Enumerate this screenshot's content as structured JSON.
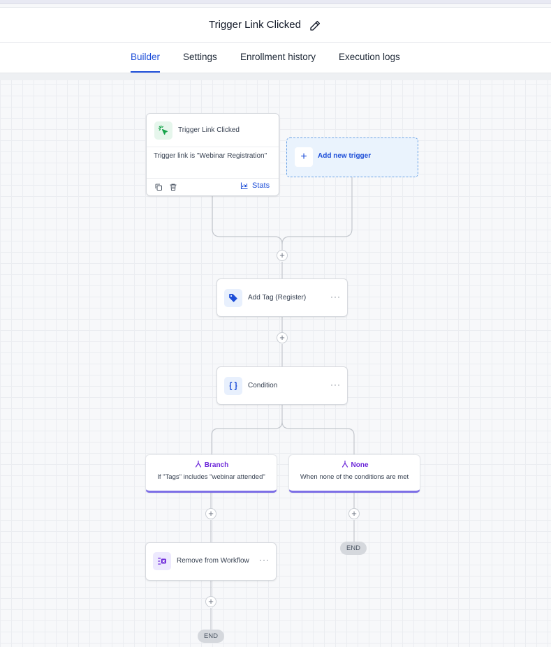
{
  "header": {
    "title": "Trigger Link Clicked"
  },
  "tabs": [
    {
      "label": "Builder",
      "active": true
    },
    {
      "label": "Settings",
      "active": false
    },
    {
      "label": "Enrollment history",
      "active": false
    },
    {
      "label": "Execution logs",
      "active": false
    }
  ],
  "trigger": {
    "name": "Trigger Link Clicked",
    "detail": "Trigger link is \"Webinar Registration\"",
    "stats_label": "Stats"
  },
  "add_trigger": {
    "label": "Add new trigger"
  },
  "actions": {
    "add_tag": {
      "label": "Add Tag (Register)"
    },
    "condition": {
      "label": "Condition"
    },
    "remove": {
      "label": "Remove from Workflow"
    }
  },
  "branches": {
    "branch": {
      "title": "Branch",
      "desc": "If \"Tags\" includes \"webinar attended\""
    },
    "none": {
      "title": "None",
      "desc": "When none of the conditions are met"
    }
  },
  "plus_symbol": "+",
  "more_symbol": "···",
  "end_label": "END",
  "colors": {
    "accent": "#1d4ed8",
    "branch": "#7c6ee6",
    "trigger_icon": "#16a34a"
  }
}
